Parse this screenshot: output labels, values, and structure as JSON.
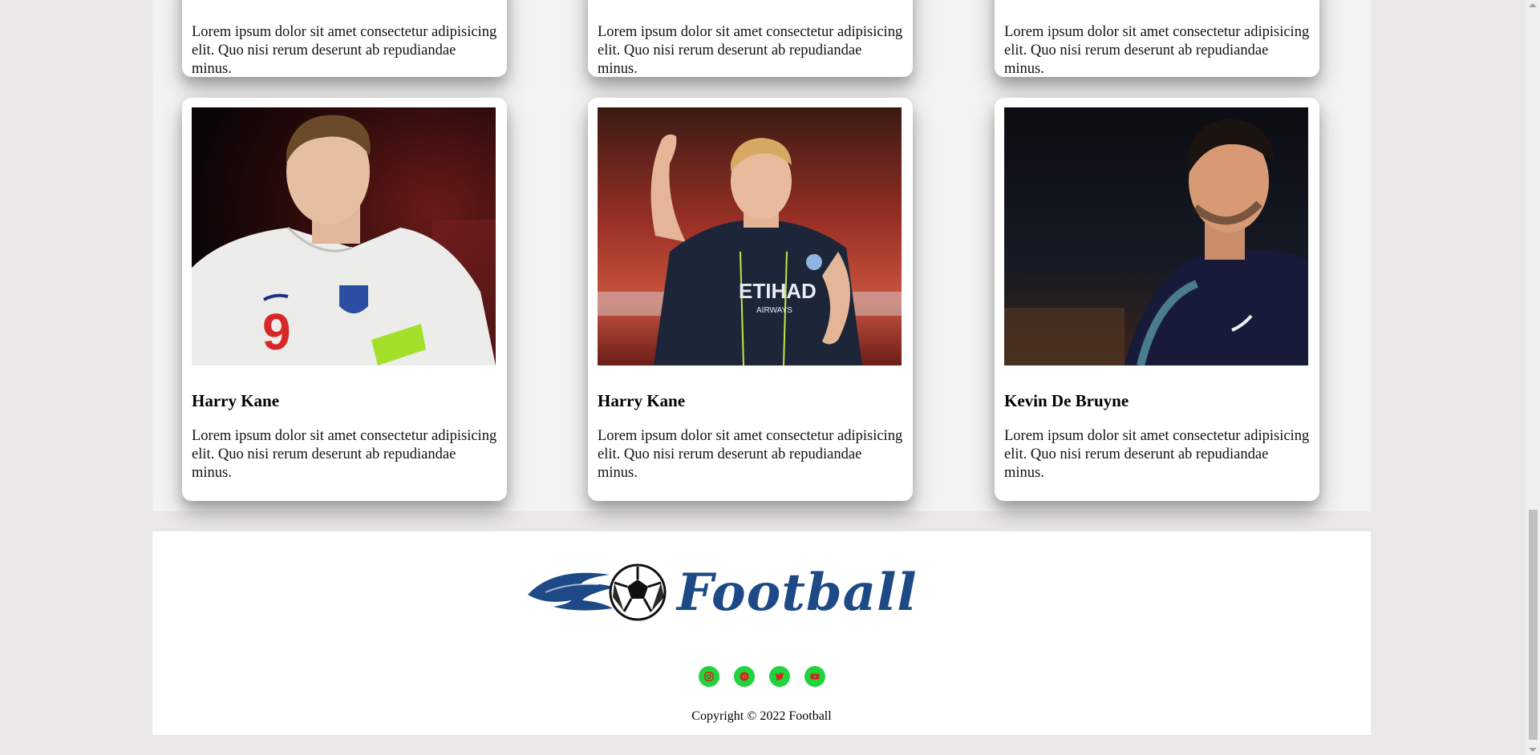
{
  "cards_top": [
    {
      "text": "Lorem ipsum dolor sit amet consectetur adipisicing elit. Quo nisi rerum deserunt ab repudiandae minus."
    },
    {
      "text": "Lorem ipsum dolor sit amet consectetur adipisicing elit. Quo nisi rerum deserunt ab repudiandae minus."
    },
    {
      "text": "Lorem ipsum dolor sit amet consectetur adipisicing elit. Quo nisi rerum deserunt ab repudiandae minus."
    }
  ],
  "cards_bottom": [
    {
      "name": "Harry Kane",
      "text": "Lorem ipsum dolor sit amet consectetur adipisicing elit. Quo nisi rerum deserunt ab repudiandae minus.",
      "jersey_number": "9"
    },
    {
      "name": "Harry Kane",
      "text": "Lorem ipsum dolor sit amet consectetur adipisicing elit. Quo nisi rerum deserunt ab repudiandae minus.",
      "shirt_sponsor": "ETIHAD",
      "shirt_sponsor_sub": "AIRWAYS"
    },
    {
      "name": "Kevin De Bruyne",
      "text": "Lorem ipsum dolor sit amet consectetur adipisicing elit. Quo nisi rerum deserunt ab repudiandae minus."
    }
  ],
  "footer": {
    "logo_text": "Football",
    "socials": [
      {
        "icon": "instagram-icon"
      },
      {
        "icon": "chrome-icon"
      },
      {
        "icon": "twitter-icon"
      },
      {
        "icon": "youtube-icon"
      }
    ],
    "copyright": "Copyright © 2022 Football"
  },
  "colors": {
    "social_bg": "#1fd43d",
    "social_icon": "#e11d1d",
    "logo_blue": "#1d4a86"
  }
}
